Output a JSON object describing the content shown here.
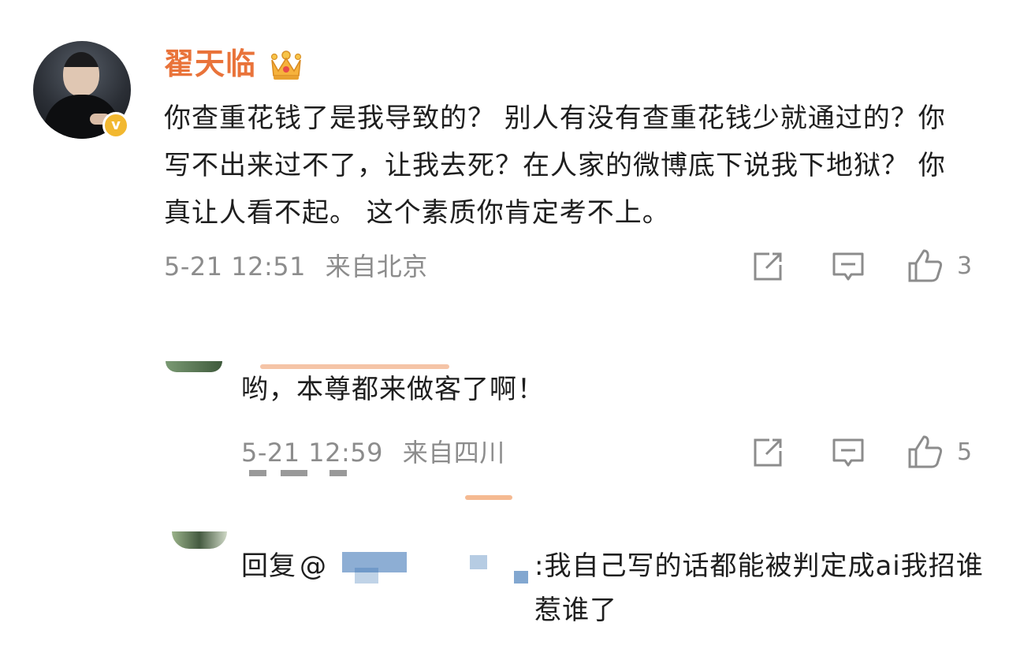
{
  "comment": {
    "username": "翟天临",
    "badge_icon": "crown-icon",
    "verified_icon": "verified-v-icon",
    "verified_mark": "v",
    "text": "你查重花钱了是我导致的？ 别人有没有查重花钱少就通过的？你写不出来过不了，让我去死？在人家的微博底下说我下地狱？  你真让人看不起。 这个素质你肯定考不上。",
    "timestamp": "5-21 12:51",
    "source": "来自北京",
    "like_count": "3"
  },
  "replies": [
    {
      "text": "哟，本尊都来做客了啊！",
      "timestamp": "5-21 12:59",
      "source": "来自四川",
      "like_count": "5"
    },
    {
      "reply_prefix": "回复",
      "mention_at": "@",
      "text_after_mention": ":我自己写的话都能被判定成ai我招谁惹谁了"
    }
  ],
  "icons": {
    "repost": "repost-icon",
    "comment": "comment-icon",
    "like": "thumbs-up-icon"
  },
  "colors": {
    "username": "#e9733a",
    "meta_gray": "#8c8c8c",
    "verified_gold": "#f2b830",
    "redaction_blue": "#2f6cb0"
  }
}
